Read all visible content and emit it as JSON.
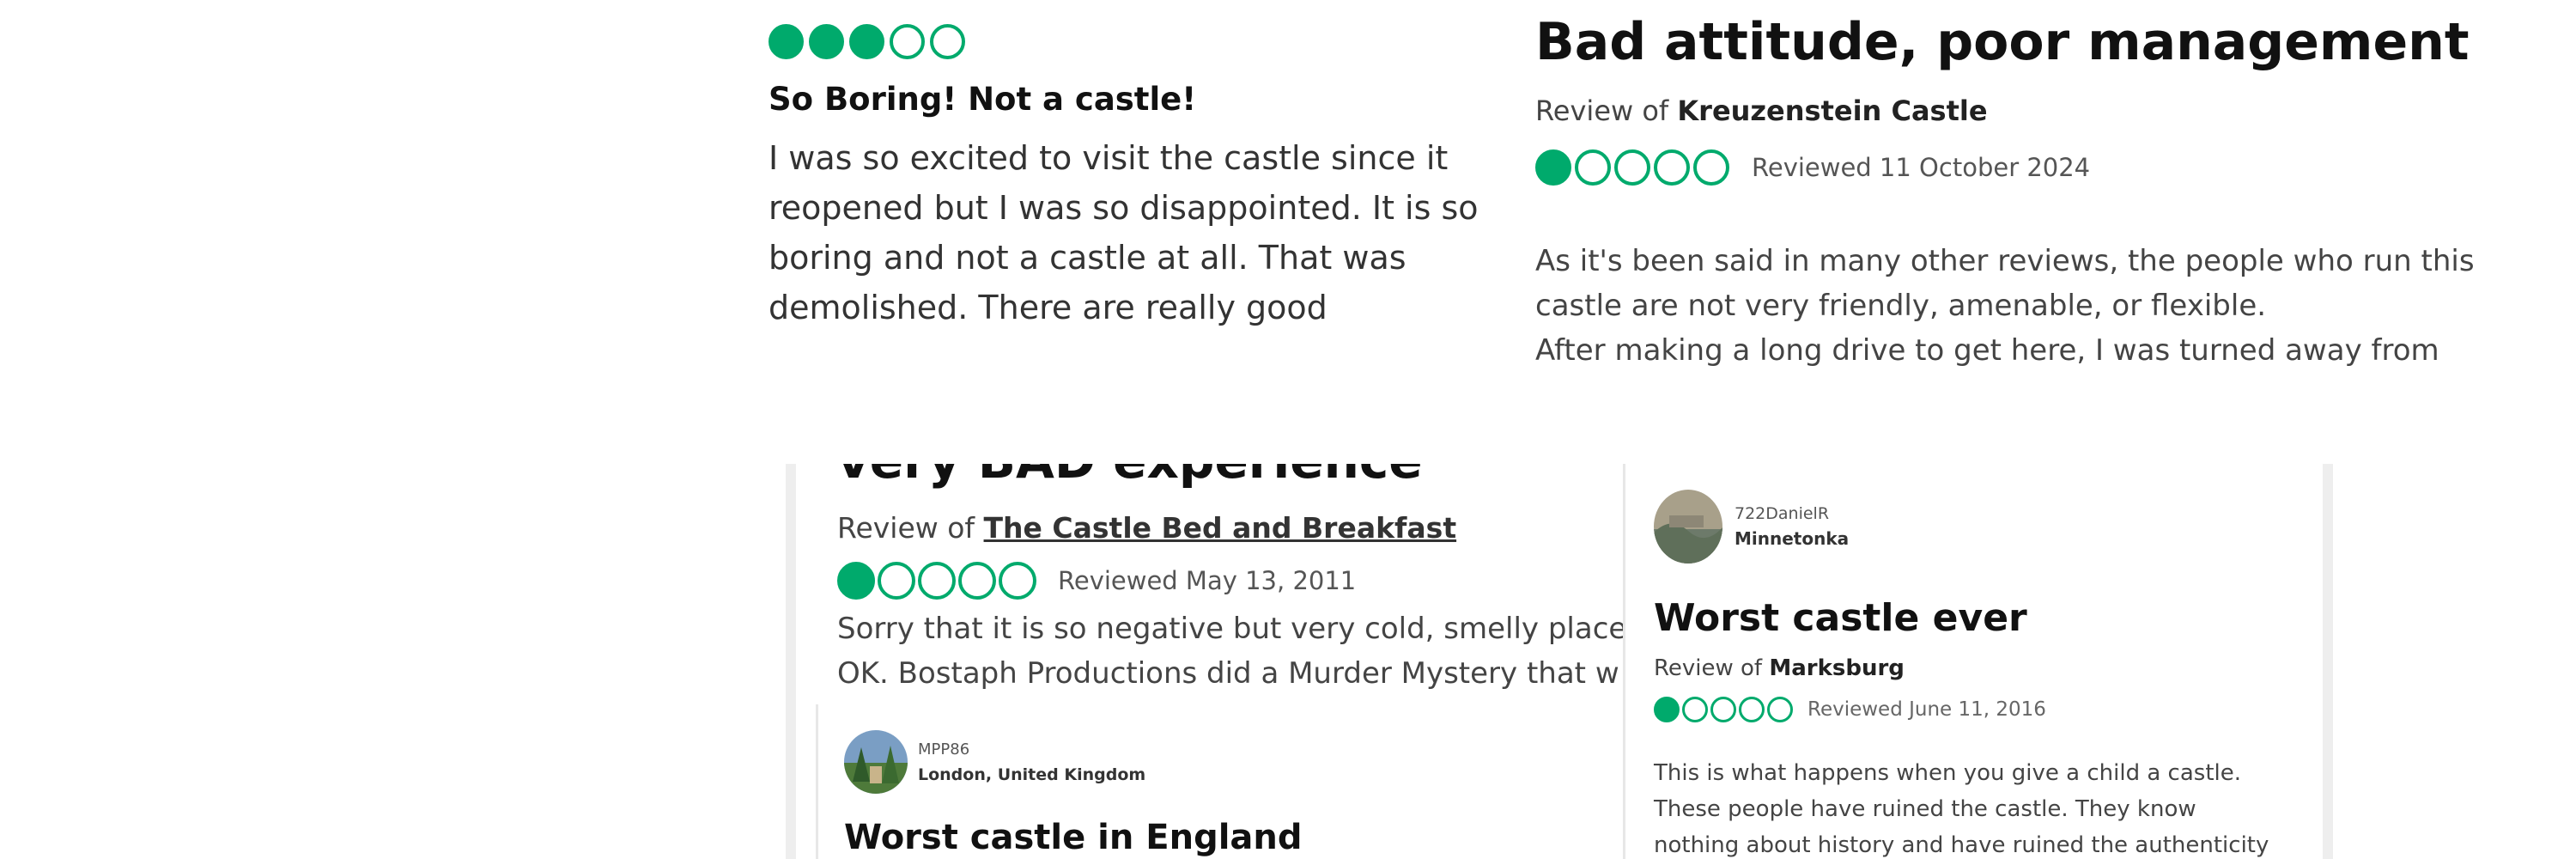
{
  "colors": {
    "accent": "#00aa6c"
  },
  "cards": [
    {
      "rating": 3,
      "title": "So Boring! Not a castle!",
      "body": "I was so excited to visit the castle since it reopened but I was so disappointed. It is so boring and not a castle at all. That was demolished. There are really good"
    },
    {
      "title": "Bad attitude, poor management",
      "review_of_prefix": "Review of",
      "review_of_place": "Kreuzenstein Castle",
      "rating": 1,
      "date": "Reviewed 11 October 2024",
      "body_lines": [
        "As it's been said in many other reviews, the people who run this castle are not very friendly, amenable, or flexible.",
        "After making a long drive to get here, I was turned away from"
      ]
    },
    {
      "title": "very BAD experience",
      "review_of_prefix": "Review of",
      "review_of_place": "The Castle Bed and Breakfast",
      "rating": 1,
      "date": "Reviewed May 13, 2011",
      "body_lines": [
        "Sorry that it is so negative but very cold, smelly place",
        "OK. Bostaph Productions did a Murder Mystery that w"
      ]
    },
    {
      "user_name": "MPP86",
      "user_location": "London, United Kingdom",
      "avatar_icon": "avatar-photo-icon",
      "title": "Worst castle in England"
    },
    {
      "user_name": "722DanielR",
      "user_location": "Minnetonka",
      "avatar_icon": "avatar-photo-icon",
      "title": "Worst castle ever",
      "review_of_prefix": "Review of",
      "review_of_place": "Marksburg",
      "rating": 1,
      "date": "Reviewed June 11, 2016",
      "body": "This is what happens when you give a child a castle. These people have ruined the castle. They know nothing about history and have ruined the authenticity of the castle. Natalia"
    }
  ]
}
